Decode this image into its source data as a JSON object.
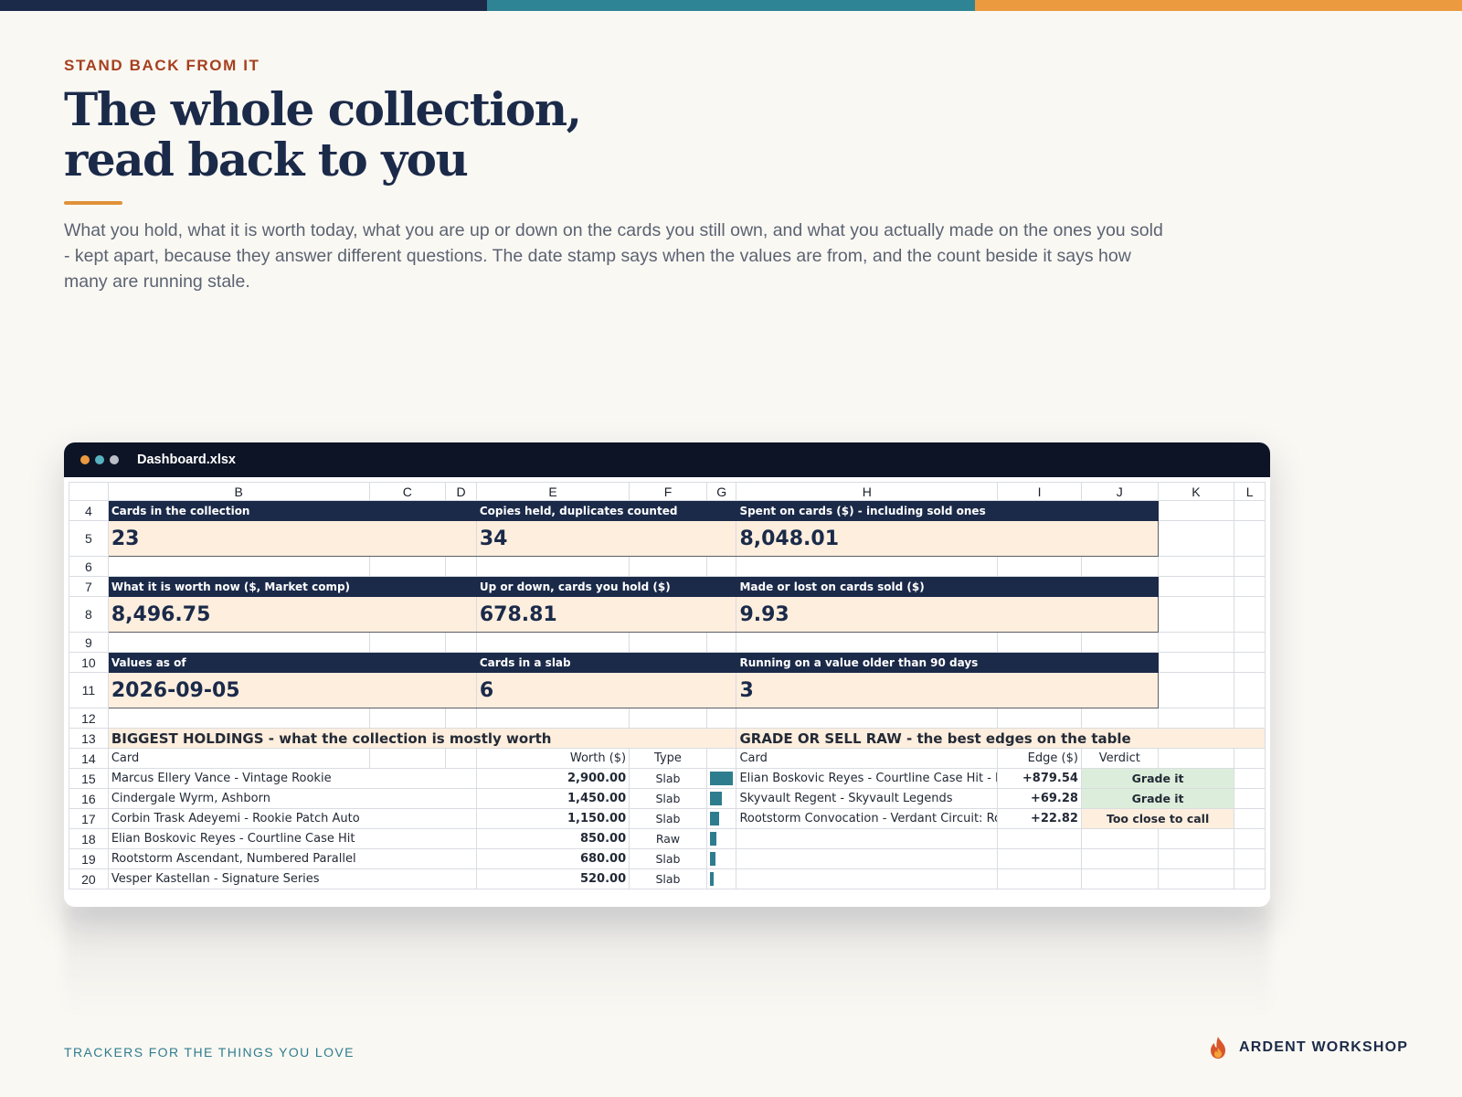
{
  "colors": {
    "navy": "#1b2a49",
    "teal": "#2e8495",
    "orange": "#ec9a3f",
    "cream": "#fdeede",
    "green": "#dceedb"
  },
  "eyebrow": "STAND BACK FROM IT",
  "headline": {
    "line1": "The whole collection,",
    "line2": "read back to you"
  },
  "intro": "What you hold, what it is worth today, what you are up or down on the cards you still own, and what you actually made on the ones you sold - kept apart, because they answer different questions. The date stamp says when the values are from, and the count beside it says how many are running stale.",
  "window": {
    "filename": "Dashboard.xlsx"
  },
  "sheet": {
    "columns": [
      "B",
      "C",
      "D",
      "E",
      "F",
      "G",
      "H",
      "I",
      "J",
      "K",
      "L"
    ],
    "rows": {
      "r4": "4",
      "r5": "5",
      "r6": "6",
      "r7": "7",
      "r8": "8",
      "r9": "9",
      "r10": "10",
      "r11": "11",
      "r12": "12",
      "r13": "13",
      "r14": "14"
    },
    "kpi": {
      "cards_label": "Cards in the collection",
      "cards_value": "23",
      "copies_label": "Copies held, duplicates counted",
      "copies_value": "34",
      "spent_label": "Spent on cards ($) - including sold ones",
      "spent_value": "8,048.01",
      "worth_label": "What it is worth now ($, Market comp)",
      "worth_value": "8,496.75",
      "updown_label": "Up or down, cards you hold ($)",
      "updown_value": "678.81",
      "made_label": "Made or lost on cards sold ($)",
      "made_value": "9.93",
      "asof_label": "Values as of",
      "asof_value": "2026-09-05",
      "slab_label": "Cards in a slab",
      "slab_value": "6",
      "stale_label": "Running on a value older than 90 days",
      "stale_value": "3"
    },
    "holdings": {
      "title": "BIGGEST HOLDINGS  -  what the collection is mostly worth",
      "col_card": "Card",
      "col_worth": "Worth ($)",
      "col_type": "Type",
      "max_worth": 2900,
      "items": [
        {
          "row": "15",
          "card": "Marcus Ellery Vance - Vintage Rookie",
          "worth": "2,900.00",
          "worth_num": 2900,
          "type": "Slab"
        },
        {
          "row": "16",
          "card": "Cindergale Wyrm, Ashborn",
          "worth": "1,450.00",
          "worth_num": 1450,
          "type": "Slab"
        },
        {
          "row": "17",
          "card": "Corbin Trask Adeyemi - Rookie Patch Auto",
          "worth": "1,150.00",
          "worth_num": 1150,
          "type": "Slab"
        },
        {
          "row": "18",
          "card": "Elian Boskovic Reyes - Courtline Case Hit",
          "worth": "850.00",
          "worth_num": 850,
          "type": "Raw"
        },
        {
          "row": "19",
          "card": "Rootstorm Ascendant, Numbered Parallel",
          "worth": "680.00",
          "worth_num": 680,
          "type": "Slab"
        },
        {
          "row": "20",
          "card": "Vesper Kastellan - Signature Series",
          "worth": "520.00",
          "worth_num": 520,
          "type": "Slab"
        }
      ]
    },
    "grade": {
      "title": "GRADE OR SELL RAW  -  the best edges on the table",
      "col_card": "Card",
      "col_edge": "Edge ($)",
      "col_verdict": "Verdict",
      "items": [
        {
          "card": "Elian Boskovic Reyes - Courtline Case Hit  -  Bl",
          "edge": "+879.54",
          "verdict": "Grade it"
        },
        {
          "card": "Skyvault Regent  -  Skyvault Legends",
          "edge": "+69.28",
          "verdict": "Grade it"
        },
        {
          "card": "Rootstorm Convocation  -  Verdant Circuit: Ro",
          "edge": "+22.82",
          "verdict": "Too close to call"
        }
      ]
    }
  },
  "footer": {
    "tagline": "TRACKERS FOR THE THINGS YOU LOVE",
    "brand": "ARDENT WORKSHOP",
    "brand_icon": "flame-icon"
  }
}
